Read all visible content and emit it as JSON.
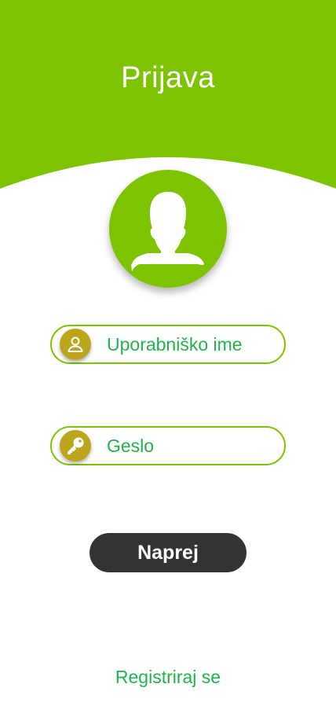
{
  "header": {
    "title": "Prijava"
  },
  "avatar": {
    "icon": "user-silhouette-icon"
  },
  "form": {
    "username": {
      "placeholder": "Uporabniško ime",
      "value": "",
      "icon": "person-icon"
    },
    "password": {
      "placeholder": "Geslo",
      "value": "",
      "icon": "key-icon"
    },
    "submit_label": "Naprej"
  },
  "footer": {
    "register_label": "Registriraj se"
  },
  "colors": {
    "brand_green": "#7dc300",
    "text_green": "#22b14c",
    "icon_gold": "#bba51c",
    "button_dark": "#333333"
  }
}
